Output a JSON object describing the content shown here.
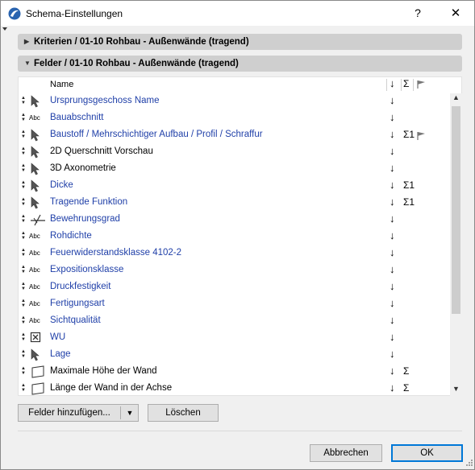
{
  "window": {
    "title": "Schema-Einstellungen",
    "help_label": "?",
    "close_label": "✕"
  },
  "sections": {
    "criteria": {
      "label": "Kriterien / 01-10 Rohbau - Außenwände (tragend)",
      "expanded": false
    },
    "fields": {
      "label": "Felder / 01-10 Rohbau - Außenwände (tragend)",
      "expanded": true
    }
  },
  "list": {
    "header": {
      "name": "Name",
      "arrow": "↓",
      "sigma": "Σ",
      "flag": "flag-icon"
    },
    "rows": [
      {
        "icon": "arrow-pointer-icon",
        "icon_text": "",
        "label": "Ursprungsgeschoss Name",
        "blue": true,
        "arrow": "↓",
        "sigma": "",
        "flag": false
      },
      {
        "icon": "abc-icon",
        "icon_text": "Abc",
        "label": "Bauabschnitt",
        "blue": true,
        "arrow": "↓",
        "sigma": "",
        "flag": false
      },
      {
        "icon": "arrow-pointer-icon",
        "icon_text": "",
        "label": "Baustoff / Mehrschichtiger Aufbau / Profil / Schraffur",
        "blue": true,
        "arrow": "↓",
        "sigma": "Σ1",
        "flag": true
      },
      {
        "icon": "arrow-pointer-icon",
        "icon_text": "",
        "label": "2D Querschnitt Vorschau",
        "blue": false,
        "arrow": "↓",
        "sigma": "",
        "flag": false
      },
      {
        "icon": "arrow-pointer-icon",
        "icon_text": "",
        "label": "3D Axonometrie",
        "blue": false,
        "arrow": "↓",
        "sigma": "",
        "flag": false
      },
      {
        "icon": "arrow-pointer-icon",
        "icon_text": "",
        "label": "Dicke",
        "blue": true,
        "arrow": "↓",
        "sigma": "Σ1",
        "flag": false
      },
      {
        "icon": "arrow-pointer-icon",
        "icon_text": "",
        "label": "Tragende Funktion",
        "blue": true,
        "arrow": "↓",
        "sigma": "Σ1",
        "flag": false
      },
      {
        "icon": "reinforcement-icon",
        "icon_text": "",
        "label": "Bewehrungsgrad",
        "blue": true,
        "arrow": "↓",
        "sigma": "",
        "flag": false
      },
      {
        "icon": "abc-icon",
        "icon_text": "Abc",
        "label": "Rohdichte",
        "blue": true,
        "arrow": "↓",
        "sigma": "",
        "flag": false
      },
      {
        "icon": "abc-icon",
        "icon_text": "Abc",
        "label": "Feuerwiderstandsklasse 4102-2",
        "blue": true,
        "arrow": "↓",
        "sigma": "",
        "flag": false
      },
      {
        "icon": "abc-icon",
        "icon_text": "Abc",
        "label": "Expositionsklasse",
        "blue": true,
        "arrow": "↓",
        "sigma": "",
        "flag": false
      },
      {
        "icon": "abc-icon",
        "icon_text": "Abc",
        "label": "Druckfestigkeit",
        "blue": true,
        "arrow": "↓",
        "sigma": "",
        "flag": false
      },
      {
        "icon": "abc-icon",
        "icon_text": "Abc",
        "label": "Fertigungsart",
        "blue": true,
        "arrow": "↓",
        "sigma": "",
        "flag": false
      },
      {
        "icon": "abc-icon",
        "icon_text": "Abc",
        "label": "Sichtqualität",
        "blue": true,
        "arrow": "↓",
        "sigma": "",
        "flag": false
      },
      {
        "icon": "checkbox-icon",
        "icon_text": "",
        "label": "WU",
        "blue": true,
        "arrow": "↓",
        "sigma": "",
        "flag": false
      },
      {
        "icon": "arrow-pointer-icon",
        "icon_text": "",
        "label": "Lage",
        "blue": true,
        "arrow": "↓",
        "sigma": "",
        "flag": false
      },
      {
        "icon": "wall-height-icon",
        "icon_text": "",
        "label": "Maximale Höhe der Wand",
        "blue": false,
        "arrow": "↓",
        "sigma": "Σ",
        "flag": false
      },
      {
        "icon": "wall-height-icon",
        "icon_text": "",
        "label": "Länge der Wand in der Achse",
        "blue": false,
        "arrow": "↓",
        "sigma": "Σ",
        "flag": false
      }
    ]
  },
  "buttons": {
    "add_fields": "Felder hinzufügen...",
    "delete": "Löschen",
    "cancel": "Abbrechen",
    "ok": "OK"
  },
  "colors": {
    "link_blue": "#1f3fa8",
    "header_gray": "#cfcfcf",
    "ok_border": "#0078d7"
  }
}
